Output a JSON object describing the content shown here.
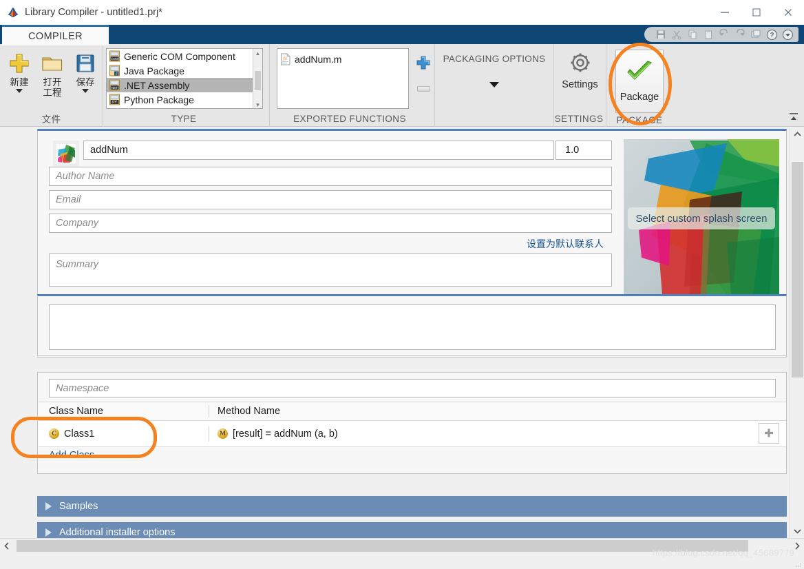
{
  "window": {
    "title": "Library Compiler - untitled1.prj*",
    "logo_icon": "matlab-membrane-icon",
    "minimize_label": "—",
    "maximize_label": "❑",
    "close_label": "✕"
  },
  "quick_access": {
    "items": [
      {
        "name": "save-icon",
        "glyph": "💾"
      },
      {
        "name": "cut-icon",
        "glyph": "✂"
      },
      {
        "name": "copy-icon",
        "glyph": "⧉"
      },
      {
        "name": "paste-icon",
        "glyph": "📋"
      },
      {
        "name": "undo-icon",
        "glyph": "↶"
      },
      {
        "name": "redo-icon",
        "glyph": "↷"
      },
      {
        "name": "layout-icon",
        "glyph": "❐"
      },
      {
        "name": "help-icon",
        "glyph": "?"
      },
      {
        "name": "more-icon",
        "glyph": "▾"
      }
    ]
  },
  "ribbon": {
    "tab_label": "COMPILER",
    "collapse_icon": "collapse-ribbon-icon",
    "groups": [
      {
        "key": "file",
        "label": "文件",
        "buttons": [
          {
            "name": "new-button",
            "label": "新建",
            "icon": "gold-plus-icon",
            "has_dropdown": true
          },
          {
            "name": "open-project-button",
            "label": "打开\n工程",
            "line1": "打开",
            "line2": "工程",
            "icon": "folder-icon",
            "has_dropdown": false
          },
          {
            "name": "save-button",
            "label": "保存",
            "icon": "floppy-disk-icon",
            "has_dropdown": true
          }
        ]
      },
      {
        "key": "type",
        "label": "TYPE",
        "items": [
          {
            "label": "Generic COM Component",
            "icon": "com-file-icon",
            "badge": "COM",
            "selected": false
          },
          {
            "label": "Java Package",
            "icon": "java-file-icon",
            "badge": "J",
            "selected": false
          },
          {
            "label": ".NET Assembly",
            "icon": "net-file-icon",
            "badge": "NET",
            "selected": true
          },
          {
            "label": "Python Package",
            "icon": "python-file-icon",
            "badge": "PY",
            "selected": false
          }
        ]
      },
      {
        "key": "exported_functions",
        "label": "EXPORTED FUNCTIONS",
        "items": [
          {
            "label": "addNum.m",
            "icon": "fx-file-icon"
          }
        ],
        "add_icon": "blue-plus-icon",
        "remove_icon": "minus-icon"
      },
      {
        "key": "packaging_options",
        "label": "PACKAGING OPTIONS",
        "dropdown_icon": "chevron-down-icon"
      },
      {
        "key": "settings",
        "label": "SETTINGS",
        "button_label": "Settings",
        "button_icon": "gear-icon"
      },
      {
        "key": "package",
        "label": "PACKAGE",
        "button_label": "Package",
        "button_icon": "green-check-icon",
        "highlighted": true
      }
    ]
  },
  "main": {
    "library_icon": "matlab-library-icon",
    "name_value": "addNum",
    "version_value": "1.0",
    "author_placeholder": "Author Name",
    "author_value": "",
    "email_placeholder": "Email",
    "email_value": "",
    "company_placeholder": "Company",
    "company_value": "",
    "default_contact_link": "设置为默认联系人",
    "summary_placeholder": "Summary",
    "summary_value": "",
    "description_placeholder": "",
    "description_value": "",
    "splash": {
      "caption": "Select custom splash screen"
    },
    "namespace_placeholder": "Namespace",
    "namespace_value": "",
    "table": {
      "columns": [
        "Class Name",
        "Method Name"
      ],
      "rows": [
        {
          "class_name": "Class1",
          "class_icon": "class-c-icon",
          "class_icon_letter": "C",
          "method_name": "[result] = addNum (a, b)",
          "method_icon": "method-m-icon",
          "method_icon_letter": "M"
        }
      ],
      "add_method_icon": "plus-icon",
      "add_class_link": "Add Class",
      "highlighted_cell": "class-name-column"
    },
    "sections": [
      {
        "label": "Samples",
        "expanded": false,
        "expander_icon": "triangle-right-icon"
      },
      {
        "label": "Additional installer options",
        "expanded": false,
        "expander_icon": "triangle-right-icon"
      }
    ]
  },
  "scrollbars": {
    "vertical": {
      "up_icon": "chevron-up-icon",
      "down_icon": "chevron-down-icon"
    },
    "horizontal": {
      "left_icon": "chevron-left-icon",
      "right_icon": "chevron-right-icon"
    }
  },
  "watermark": "https://blog.csdn.net/qq_45689779",
  "colors": {
    "titlebar_strip": "#0e4775",
    "ribbon_bg": "#e6e6e6",
    "panel_top_accent": "#4f81bd",
    "section_header": "#6a8cb5",
    "highlight_orange": "#f58220",
    "link_blue": "#1a5490",
    "gold_icon": "#d4a017",
    "check_green": "#4aa02c"
  }
}
